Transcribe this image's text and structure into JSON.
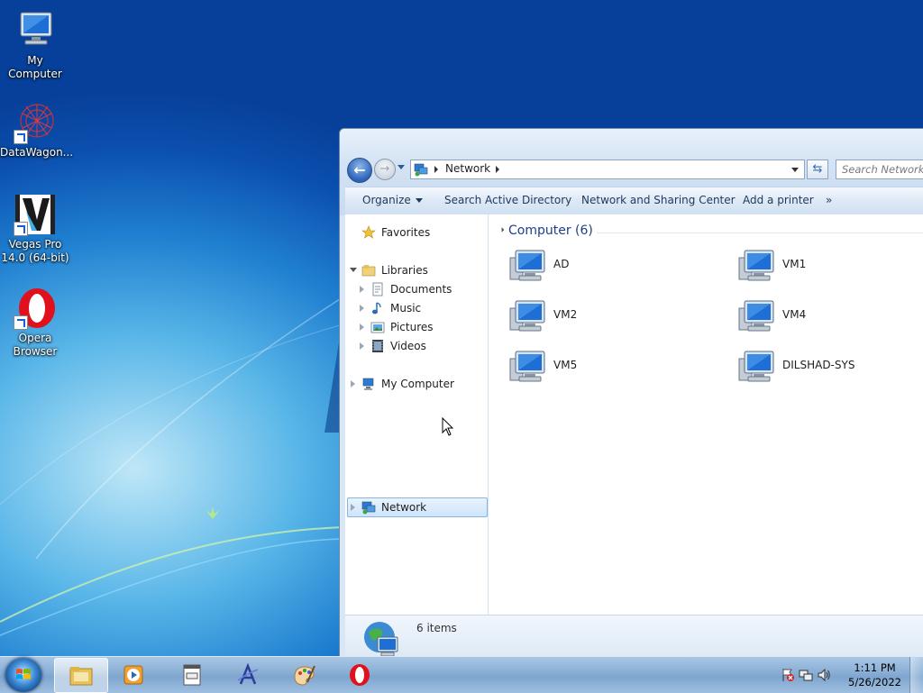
{
  "desktop": {
    "icons": [
      {
        "label": "My Computer"
      },
      {
        "label": "DataWagon..."
      },
      {
        "label": "Vegas Pro 14.0 (64-bit)"
      },
      {
        "label": "Opera Browser"
      }
    ]
  },
  "explorer": {
    "address": {
      "crumb": "Network"
    },
    "search_placeholder": "Search Network",
    "commands": {
      "organize": "Organize",
      "search_ad": "Search Active Directory",
      "network_sharing": "Network and Sharing Center",
      "add_printer": "Add a printer",
      "more": "»"
    },
    "nav": {
      "favorites": "Favorites",
      "libraries": "Libraries",
      "documents": "Documents",
      "music": "Music",
      "pictures": "Pictures",
      "videos": "Videos",
      "my_computer": "My Computer",
      "network": "Network"
    },
    "group_title": "Computer (6)",
    "computers": [
      "AD",
      "VM1",
      "VM2",
      "VM4",
      "VM5",
      "DILSHAD-SYS"
    ],
    "status": "6 items"
  },
  "taskbar": {
    "apps": [
      "windows-explorer",
      "media-player",
      "notepad-document",
      "font-app",
      "paint",
      "opera"
    ],
    "clock": {
      "time": "1:11 PM",
      "date": "5/26/2022"
    }
  },
  "colors": {
    "accent": "#1e3f8a",
    "selection": "#cfe5fb",
    "desktop": "#0a4aa8"
  }
}
